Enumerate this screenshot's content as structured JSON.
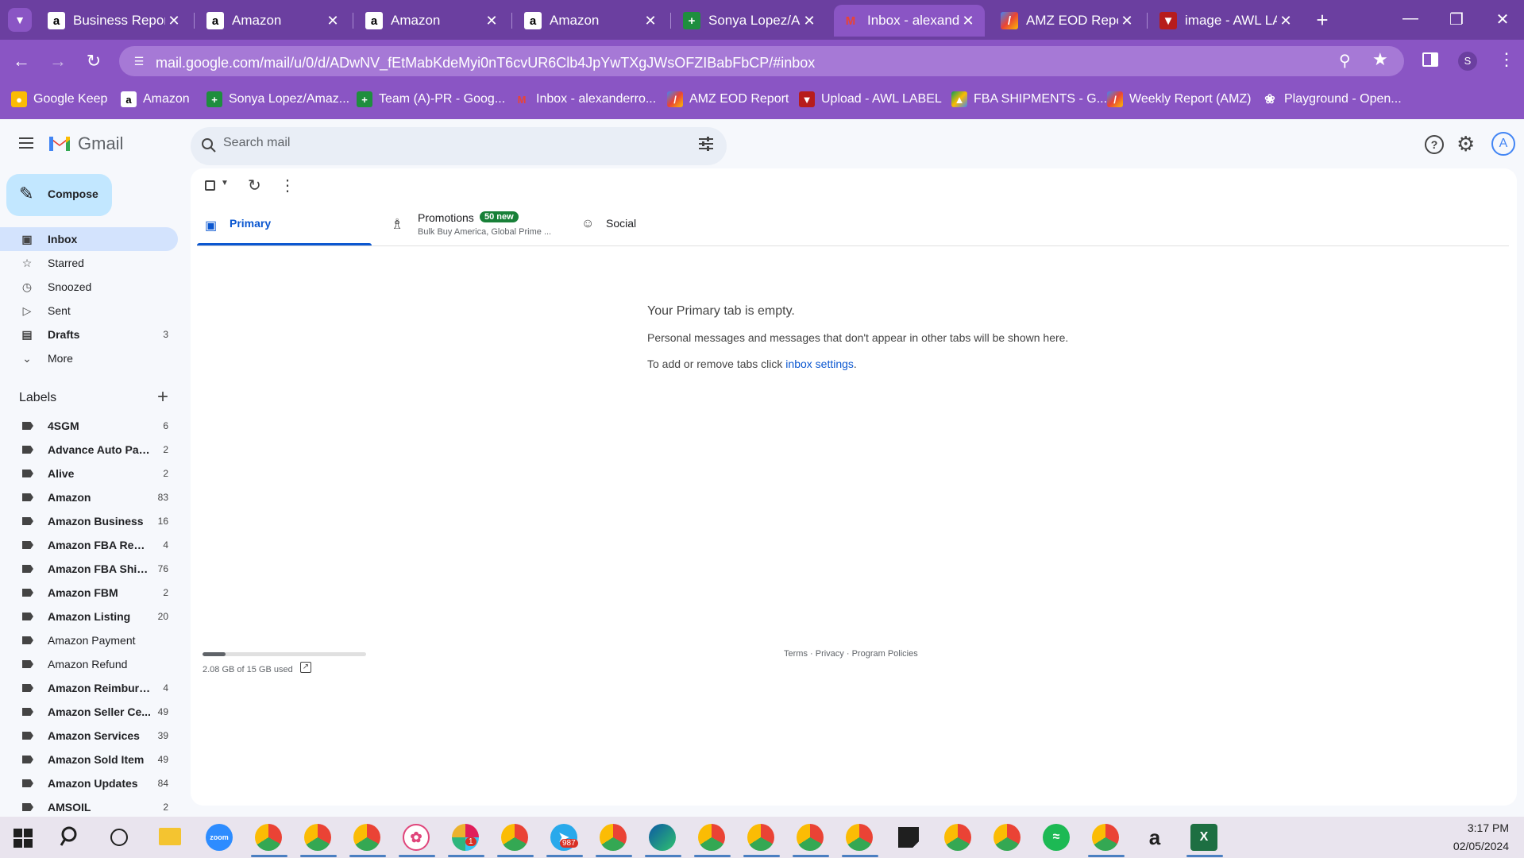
{
  "browser": {
    "tabs": [
      {
        "title": "Business Reports",
        "icon": "amazon-icon"
      },
      {
        "title": "Amazon",
        "icon": "amazon-icon"
      },
      {
        "title": "Amazon",
        "icon": "amazon-icon"
      },
      {
        "title": "Amazon",
        "icon": "amazon-icon"
      },
      {
        "title": "Sonya Lopez/Am",
        "icon": "sheets-icon"
      },
      {
        "title": "Inbox - alexande",
        "icon": "gmail-icon",
        "active": true
      },
      {
        "title": "AMZ EOD Repor",
        "icon": "pen-icon"
      },
      {
        "title": "image - AWL LA",
        "icon": "label-icon"
      }
    ],
    "url": "mail.google.com/mail/u/0/d/ADwNV_fEtMabKdeMyi0nT6cvUR6Clb4JpYwTXgJWsOFZIBabFbCP/#inbox",
    "profile_initial": "S",
    "bookmarks": [
      "Google Keep",
      "Amazon",
      "Sonya Lopez/Amaz...",
      "Team (A)-PR - Goog...",
      "Inbox - alexanderro...",
      "AMZ EOD Report",
      "Upload - AWL LABEL",
      "FBA SHIPMENTS - G...",
      "Weekly Report (AMZ)",
      "Playground - Open..."
    ]
  },
  "gmail": {
    "logo_text": "Gmail",
    "search_placeholder": "Search mail",
    "account_initial": "A",
    "compose_label": "Compose",
    "nav": [
      {
        "label": "Inbox",
        "count": "",
        "icon": "inbox-icon"
      },
      {
        "label": "Starred",
        "count": "",
        "icon": "star-icon"
      },
      {
        "label": "Snoozed",
        "count": "",
        "icon": "clock-icon"
      },
      {
        "label": "Sent",
        "count": "",
        "icon": "send-icon"
      },
      {
        "label": "Drafts",
        "count": "3",
        "icon": "draft-icon"
      },
      {
        "label": "More",
        "count": "",
        "icon": "chevron-down-icon"
      }
    ],
    "labels_heading": "Labels",
    "labels": [
      {
        "name": "4SGM",
        "count": "6",
        "bold": true
      },
      {
        "name": "Advance Auto Parts",
        "count": "2",
        "bold": true
      },
      {
        "name": "Alive",
        "count": "2",
        "bold": true
      },
      {
        "name": "Amazon",
        "count": "83",
        "bold": true
      },
      {
        "name": "Amazon Business",
        "count": "16",
        "bold": true
      },
      {
        "name": "Amazon FBA Remo...",
        "count": "4",
        "bold": true
      },
      {
        "name": "Amazon FBA Ship...",
        "count": "76",
        "bold": true
      },
      {
        "name": "Amazon FBM",
        "count": "2",
        "bold": true
      },
      {
        "name": "Amazon Listing",
        "count": "20",
        "bold": true
      },
      {
        "name": "Amazon Payment",
        "count": "",
        "bold": false
      },
      {
        "name": "Amazon Refund",
        "count": "",
        "bold": false
      },
      {
        "name": "Amazon Reimburs...",
        "count": "4",
        "bold": true
      },
      {
        "name": "Amazon Seller Ce...",
        "count": "49",
        "bold": true
      },
      {
        "name": "Amazon Services",
        "count": "39",
        "bold": true
      },
      {
        "name": "Amazon Sold Item",
        "count": "49",
        "bold": true
      },
      {
        "name": "Amazon Updates",
        "count": "84",
        "bold": true
      },
      {
        "name": "AMSOIL",
        "count": "2",
        "bold": true
      }
    ],
    "tabs": {
      "primary": "Primary",
      "promotions": "Promotions",
      "promotions_badge": "50 new",
      "promotions_sub": "Bulk Buy America, Global Prime ...",
      "social": "Social"
    },
    "empty": {
      "title": "Your Primary tab is empty.",
      "line1": "Personal messages and messages that don't appear in other tabs will be shown here.",
      "line2_prefix": "To add or remove tabs click ",
      "line2_link": "inbox settings",
      "line2_suffix": "."
    },
    "storage": {
      "text": "2.08 GB of 15 GB used",
      "fraction": 0.139
    },
    "footer": {
      "terms": "Terms",
      "dot1": " · ",
      "privacy": "Privacy",
      "dot2": " · ",
      "policies": "Program Policies"
    }
  },
  "taskbar": {
    "apps": [
      "start-icon",
      "search-icon",
      "task-view-icon",
      "file-explorer-icon",
      "zoom-icon",
      "chrome-icon",
      "chrome-icon",
      "chrome-icon",
      "app-icon",
      "slack-icon",
      "chrome-icon",
      "telegram-icon",
      "chrome-icon",
      "edge-icon",
      "chrome-icon",
      "chrome-icon",
      "chrome-icon",
      "chrome-icon",
      "sticky-notes-icon",
      "chrome-icon",
      "chrome-icon",
      "spotify-icon",
      "chrome-icon",
      "amazon-icon",
      "excel-icon"
    ],
    "badges": {
      "slack": "1",
      "telegram": "987"
    },
    "time": "3:17 PM",
    "date": "02/05/2024"
  },
  "colors": {
    "chrome_purple": "#8a55c4",
    "tabstrip_purple": "#6b3fa0",
    "gmail_bg": "#f6f8fc",
    "inbox_selected": "#d3e3fd",
    "link_blue": "#0b57d0",
    "badge_green": "#188038",
    "compose_bg": "#c2e7ff"
  }
}
